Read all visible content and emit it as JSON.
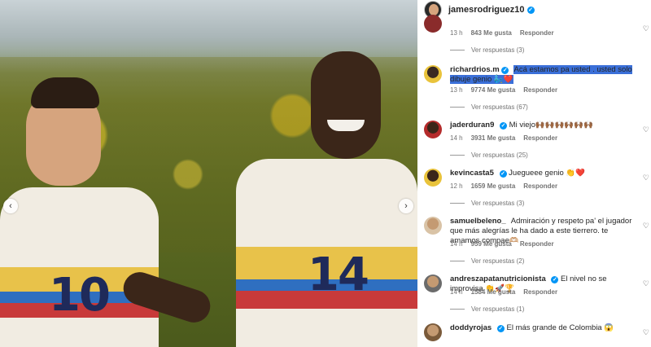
{
  "post": {
    "author": "jamesrodriguez10",
    "carousel_prev_icon": "chevron-left-icon",
    "carousel_next_icon": "chevron-right-icon",
    "jersey_left": "10",
    "jersey_right": "14"
  },
  "comments": [
    {
      "time": "13 h",
      "likes": "843 Me gusta",
      "reply": "Responder",
      "view_replies": "Ver respuestas (3)"
    },
    {
      "user": "richardrios.m",
      "text": "Acá estamos pa usted . usted solo dibuje genio 🧞‍♂️❤️",
      "time": "13 h",
      "likes": "9774 Me gusta",
      "reply": "Responder",
      "view_replies": "Ver respuestas (67)"
    },
    {
      "user": "jaderduran9",
      "text": "Mi viejo🙌🏾🙌🏾🙌🏾🙌🏾🙌🏾🙌🏾",
      "time": "14 h",
      "likes": "3931 Me gusta",
      "reply": "Responder",
      "view_replies": "Ver respuestas (25)"
    },
    {
      "user": "kevincasta5",
      "text": "Juegueee genio 👏❤️",
      "time": "12 h",
      "likes": "1659 Me gusta",
      "reply": "Responder",
      "view_replies": "Ver respuestas (3)"
    },
    {
      "user": "samuelbeleno_",
      "text": "Admiración y respeto pa' el jugador que más alegrías le ha dado a este tierrero. te amamos compae🫶🏼",
      "time": "14 h",
      "likes": "959 Me gusta",
      "reply": "Responder",
      "view_replies": "Ver respuestas (2)"
    },
    {
      "user": "andreszapatanutricionista",
      "text": "El nivel no se improvisa 👏🚀🏆",
      "time": "14 h",
      "likes": "1584 Me gusta",
      "reply": "Responder",
      "view_replies": "Ver respuestas (1)"
    },
    {
      "user": "doddyrojas",
      "text": "El más grande de Colombia 😱"
    }
  ],
  "colors": {
    "verified": "#0095f6",
    "highlight": "#3a6fd8",
    "meta": "#737373"
  }
}
